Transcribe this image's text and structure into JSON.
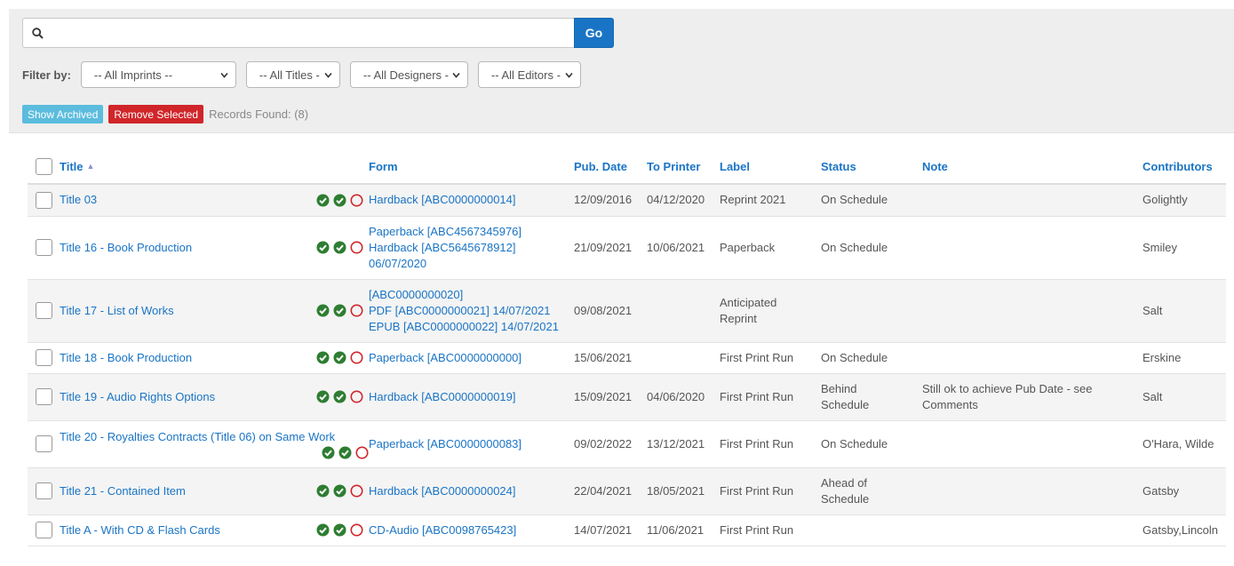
{
  "search": {
    "value": "",
    "placeholder": "",
    "go_label": "Go"
  },
  "filters": {
    "label": "Filter by:",
    "imprints": "-- All Imprints --",
    "titles": "-- All Titles -",
    "designers": "-- All Designers -",
    "editors": "-- All Editors -"
  },
  "actions": {
    "show_archived": "Show Archived",
    "remove_selected": "Remove Selected",
    "records_found": "Records Found: (8)"
  },
  "table": {
    "headers": {
      "title": "Title",
      "form": "Form",
      "pub_date": "Pub. Date",
      "to_printer": "To Printer",
      "label": "Label",
      "status": "Status",
      "note": "Note",
      "contributors": "Contributors"
    },
    "rows": [
      {
        "title": "Title 03",
        "form": [
          "Hardback [ABC0000000014]"
        ],
        "pub_date": "12/09/2016",
        "to_printer": "04/12/2020",
        "label": [
          "Reprint 2021"
        ],
        "status": [
          "On Schedule"
        ],
        "note": [],
        "contributors": "Golightly",
        "status_icons": [
          "check",
          "check",
          "circle"
        ]
      },
      {
        "title": "Title 16 - Book Production",
        "form": [
          "Paperback [ABC4567345976]",
          "Hardback [ABC5645678912]",
          "06/07/2020"
        ],
        "pub_date": "21/09/2021",
        "to_printer": "10/06/2021",
        "label": [
          "Paperback"
        ],
        "status": [
          "On Schedule"
        ],
        "note": [],
        "contributors": "Smiley",
        "status_icons": [
          "check",
          "check",
          "circle"
        ]
      },
      {
        "title": "Title 17 - List of Works",
        "form": [
          "[ABC0000000020]",
          "PDF [ABC0000000021] 14/07/2021",
          "EPUB [ABC0000000022] 14/07/2021"
        ],
        "pub_date": "09/08/2021",
        "to_printer": "",
        "label": [
          "Anticipated",
          "Reprint"
        ],
        "status": [],
        "note": [],
        "contributors": "Salt",
        "status_icons": [
          "check",
          "check",
          "circle"
        ]
      },
      {
        "title": "Title 18 - Book Production",
        "form": [
          "Paperback [ABC0000000000]"
        ],
        "pub_date": "15/06/2021",
        "to_printer": "",
        "label": [
          "First Print Run"
        ],
        "status": [
          "On Schedule"
        ],
        "note": [],
        "contributors": "Erskine",
        "status_icons": [
          "check",
          "check",
          "circle"
        ]
      },
      {
        "title": "Title 19 - Audio Rights Options",
        "form": [
          "Hardback [ABC0000000019]"
        ],
        "pub_date": "15/09/2021",
        "to_printer": "04/06/2020",
        "label": [
          "First Print Run"
        ],
        "status": [
          "Behind",
          "Schedule"
        ],
        "note": [
          "Still ok to achieve Pub Date - see",
          "Comments"
        ],
        "contributors": "Salt",
        "status_icons": [
          "check",
          "check",
          "circle"
        ]
      },
      {
        "title": "Title 20 - Royalties Contracts (Title 06) on Same Work",
        "form": [
          "Paperback [ABC0000000083]"
        ],
        "pub_date": "09/02/2022",
        "to_printer": "13/12/2021",
        "label": [
          "First Print Run"
        ],
        "status": [
          "On Schedule"
        ],
        "note": [],
        "contributors": "O'Hara, Wilde",
        "status_icons": [
          "check",
          "check",
          "circle"
        ]
      },
      {
        "title": "Title 21 - Contained Item",
        "form": [
          "Hardback [ABC0000000024]"
        ],
        "pub_date": "22/04/2021",
        "to_printer": "18/05/2021",
        "label": [
          "First Print Run"
        ],
        "status": [
          "Ahead of",
          "Schedule"
        ],
        "note": [],
        "contributors": "Gatsby",
        "status_icons": [
          "check",
          "check",
          "circle"
        ]
      },
      {
        "title": "Title A - With CD & Flash Cards",
        "form": [
          "CD-Audio [ABC0098765423]"
        ],
        "pub_date": "14/07/2021",
        "to_printer": "11/06/2021",
        "label": [
          "First Print Run"
        ],
        "status": [],
        "note": [],
        "contributors": "Gatsby,Lincoln",
        "status_icons": [
          "check",
          "check",
          "circle"
        ]
      }
    ]
  },
  "colors": {
    "link": "#1a74c5",
    "check": "#2e7d32",
    "circle": "#d0262a",
    "go": "#1a74c5",
    "archive": "#5bbcdd",
    "remove": "#d0262a"
  }
}
